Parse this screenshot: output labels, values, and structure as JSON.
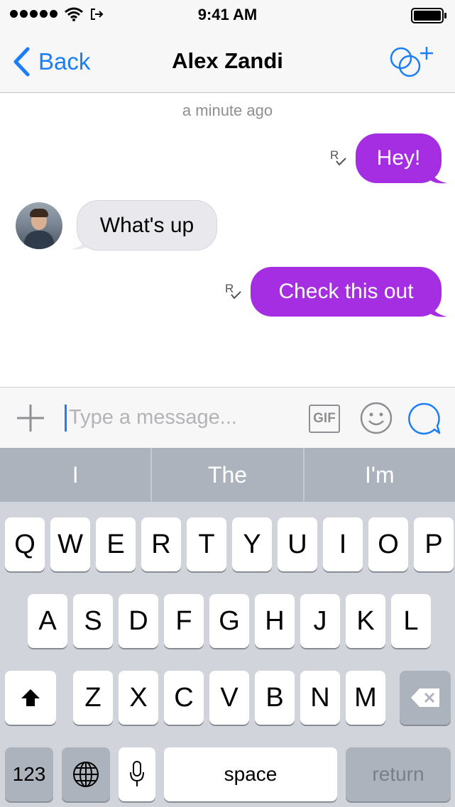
{
  "status_bar": {
    "time": "9:41 AM"
  },
  "nav": {
    "back_label": "Back",
    "title": "Alex Zandi"
  },
  "conversation": {
    "timestamp": "a minute ago",
    "messages": [
      {
        "direction": "out",
        "text": "Hey!",
        "read_receipt": "R"
      },
      {
        "direction": "in",
        "text": "What's up"
      },
      {
        "direction": "out",
        "text": "Check this out",
        "read_receipt": "R"
      }
    ]
  },
  "composer": {
    "placeholder": "Type a message...",
    "gif_label": "GIF",
    "value": ""
  },
  "suggestions": [
    "I",
    "The",
    "I'm"
  ],
  "keyboard": {
    "row1": [
      "Q",
      "W",
      "E",
      "R",
      "T",
      "Y",
      "U",
      "I",
      "O",
      "P"
    ],
    "row2": [
      "A",
      "S",
      "D",
      "F",
      "G",
      "H",
      "J",
      "K",
      "L"
    ],
    "row3": [
      "Z",
      "X",
      "C",
      "V",
      "B",
      "N",
      "M"
    ],
    "numbers_label": "123",
    "space_label": "space",
    "return_label": "return"
  },
  "colors": {
    "accent": "#1a7ef7",
    "outgoing_bubble": "#a52ee3",
    "incoming_bubble": "#e8e8ed",
    "keyboard_bg": "#d1d5db"
  },
  "icons": [
    "wifi-icon",
    "back-chevron-icon",
    "add-people-icon",
    "plus-icon",
    "emoji-icon",
    "send-bubble-icon",
    "shift-icon",
    "globe-icon",
    "microphone-icon",
    "delete-icon"
  ]
}
